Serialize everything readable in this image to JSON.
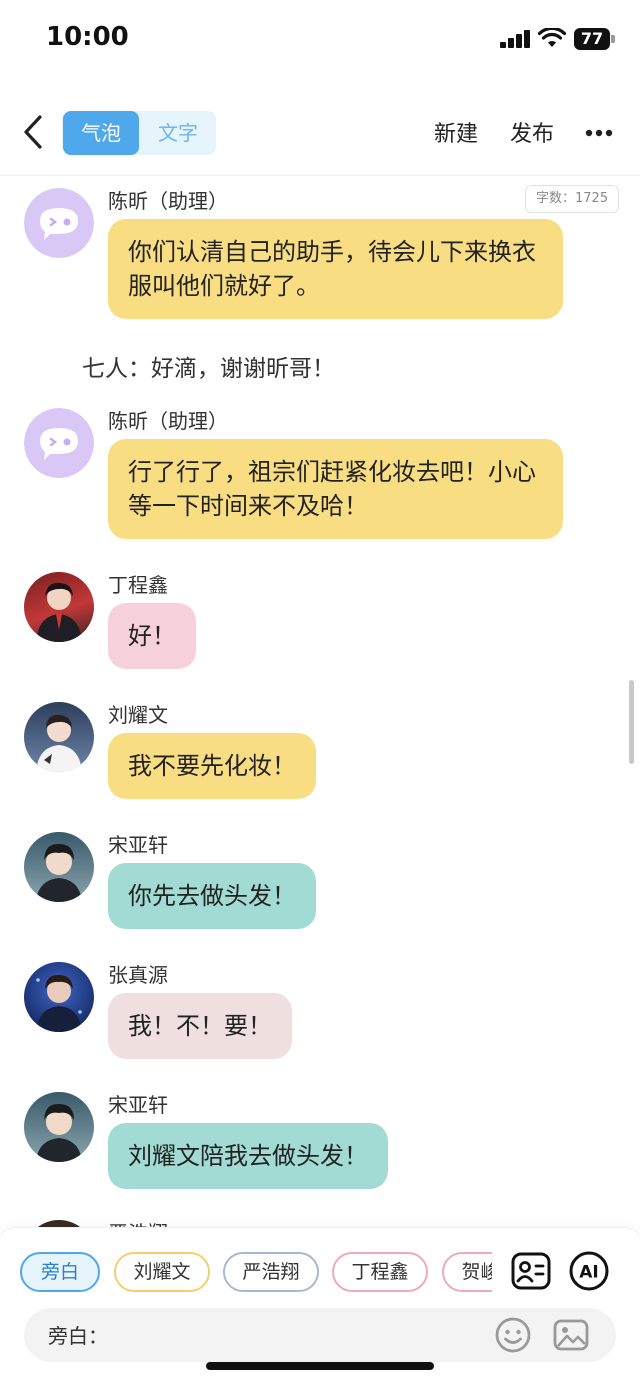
{
  "status_bar": {
    "time": "10:00",
    "battery": "77"
  },
  "toolbar": {
    "tab_bubble": "气泡",
    "tab_text": "文字",
    "new_label": "新建",
    "publish_label": "发布"
  },
  "word_count": "字数：1725",
  "messages": [
    {
      "sender": "陈昕（助理）",
      "text": "你们认清自己的助手，待会儿下来换衣服叫他们就好了。",
      "color": "#f8dd82",
      "avatar": "bubble-avatar"
    },
    {
      "narration": "七人：好滴，谢谢昕哥！"
    },
    {
      "sender": "陈昕（助理）",
      "text": "行了行了，祖宗们赶紧化妆去吧！小心等一下时间来不及哈！",
      "color": "#f8dd82",
      "avatar": "bubble-avatar"
    },
    {
      "sender": "丁程鑫",
      "text": "好！",
      "color": "#f6d0db"
    },
    {
      "sender": "刘耀文",
      "text": "我不要先化妆！",
      "color": "#f8dd82"
    },
    {
      "sender": "宋亚轩",
      "text": "你先去做头发！",
      "color": "#a2dbd4"
    },
    {
      "sender": "张真源",
      "text": "我！不！要！",
      "color": "#efdfdf"
    },
    {
      "sender": "宋亚轩",
      "text": "刘耀文陪我去做头发！",
      "color": "#a2dbd4"
    },
    {
      "sender": "严浩翔"
    }
  ],
  "chips": [
    {
      "label": "旁白",
      "border": "#4fa8ec",
      "bg": "#e6f4fc",
      "selected": true
    },
    {
      "label": "刘耀文",
      "border": "#f0d070",
      "bg": "#fff"
    },
    {
      "label": "严浩翔",
      "border": "#a8b8d0",
      "bg": "#fff"
    },
    {
      "label": "丁程鑫",
      "border": "#f0a8c0",
      "bg": "#fff"
    },
    {
      "label": "贺峻霖",
      "border": "#f0a8c0",
      "bg": "#fff"
    }
  ],
  "input": {
    "label": "旁白："
  },
  "icons": [
    "back-icon",
    "more-icon",
    "role-card-icon",
    "ai-icon",
    "emoji-icon",
    "image-icon"
  ]
}
